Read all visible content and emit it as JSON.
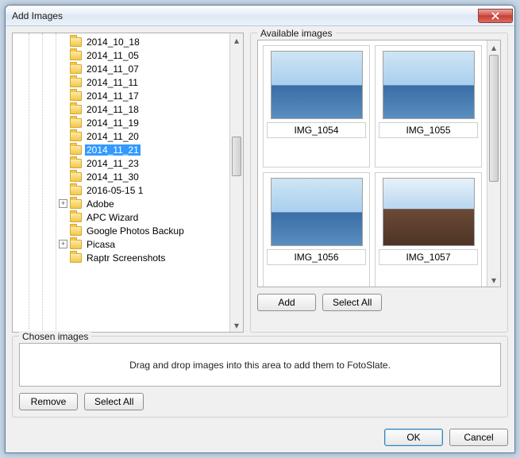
{
  "window": {
    "title": "Add Images"
  },
  "tree": {
    "items": [
      {
        "label": "2014_10_18",
        "expander": false
      },
      {
        "label": "2014_11_05",
        "expander": false
      },
      {
        "label": "2014_11_07",
        "expander": false
      },
      {
        "label": "2014_11_11",
        "expander": false
      },
      {
        "label": "2014_11_17",
        "expander": false
      },
      {
        "label": "2014_11_18",
        "expander": false
      },
      {
        "label": "2014_11_19",
        "expander": false
      },
      {
        "label": "2014_11_20",
        "expander": false
      },
      {
        "label": "2014_11_21",
        "expander": false,
        "selected": true
      },
      {
        "label": "2014_11_23",
        "expander": false
      },
      {
        "label": "2014_11_30",
        "expander": false
      },
      {
        "label": "2016-05-15 1",
        "expander": false
      },
      {
        "label": "Adobe",
        "expander": true
      },
      {
        "label": "APC Wizard",
        "expander": false
      },
      {
        "label": "Google Photos Backup",
        "expander": false
      },
      {
        "label": "Picasa",
        "expander": true
      },
      {
        "label": "Raptr Screenshots",
        "expander": false
      }
    ]
  },
  "available": {
    "group_label": "Available images",
    "thumbs": [
      {
        "name": "IMG_1054",
        "style": "sea"
      },
      {
        "name": "IMG_1055",
        "style": "sea"
      },
      {
        "name": "IMG_1056",
        "style": "sea"
      },
      {
        "name": "IMG_1057",
        "style": "deck"
      }
    ],
    "add_label": "Add",
    "select_all_label": "Select All"
  },
  "chosen": {
    "group_label": "Chosen images",
    "empty_text": "Drag and drop images into this area to add them to FotoSlate.",
    "remove_label": "Remove",
    "select_all_label": "Select All"
  },
  "footer": {
    "ok_label": "OK",
    "cancel_label": "Cancel"
  }
}
